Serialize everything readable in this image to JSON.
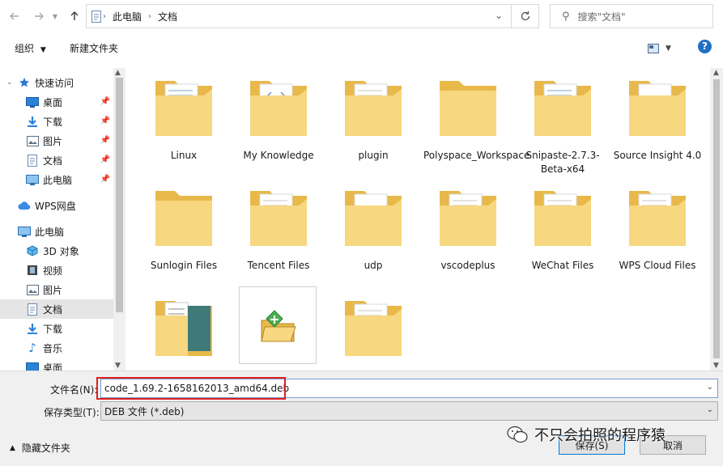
{
  "address": {
    "crumbs": [
      "此电脑",
      "文档"
    ]
  },
  "search": {
    "placeholder": "搜索\"文档\""
  },
  "toolbar": {
    "organize": "组织",
    "new_folder": "新建文件夹",
    "help": "?"
  },
  "nav": {
    "quick_access": "快速访问",
    "quick_items": [
      "桌面",
      "下载",
      "图片",
      "文档",
      "此电脑"
    ],
    "wps_drive": "WPS网盘",
    "this_pc": "此电脑",
    "pc_items": [
      "3D 对象",
      "视频",
      "图片",
      "文档",
      "下载",
      "音乐",
      "桌面"
    ]
  },
  "files": [
    {
      "name": "Linux",
      "kind": "folder-docs"
    },
    {
      "name": "My Knowledge",
      "kind": "folder-code"
    },
    {
      "name": "plugin",
      "kind": "folder-docs"
    },
    {
      "name": "Polyspace_Workspace",
      "kind": "folder-plain"
    },
    {
      "name": "Snipaste-2.7.3-Beta-x64",
      "kind": "folder-docs"
    },
    {
      "name": "Source Insight 4.0",
      "kind": "folder-app"
    },
    {
      "name": "Sunlogin Files",
      "kind": "folder-plain"
    },
    {
      "name": "Tencent Files",
      "kind": "folder-docs"
    },
    {
      "name": "udp",
      "kind": "folder-app"
    },
    {
      "name": "vscodeplus",
      "kind": "folder-docs"
    },
    {
      "name": "WeChat Files",
      "kind": "folder-docs"
    },
    {
      "name": "WPS Cloud Files",
      "kind": "folder-docs"
    },
    {
      "name": "",
      "kind": "folder-photo"
    },
    {
      "name": "",
      "kind": "wps-app"
    },
    {
      "name": "",
      "kind": "folder-docs"
    }
  ],
  "bottom": {
    "filename_label": "文件名(N):",
    "filename_value": "code_1.69.2-1658162013_amd64.deb",
    "filetype_label": "保存类型(T):",
    "filetype_value": "DEB 文件 (*.deb)",
    "hide_folders": "隐藏文件夹",
    "save": "保存(S)",
    "cancel": "取消"
  },
  "watermark": {
    "text": "不只会拍照的程序猿"
  },
  "colors": {
    "folder": "#f5d57a",
    "folder_dark": "#e8b94a",
    "accent": "#0078d7",
    "highlight": "#e02020"
  }
}
